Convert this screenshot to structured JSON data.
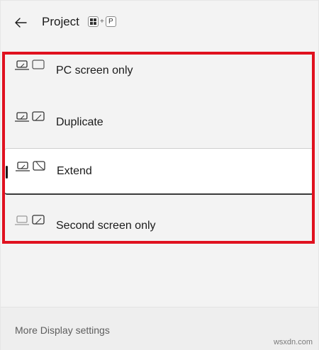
{
  "header": {
    "title": "Project",
    "shortcut": {
      "plus": "+",
      "key": "P"
    }
  },
  "modes": [
    {
      "label": "PC screen only",
      "icon": "pc-screen-only-icon",
      "selected": false
    },
    {
      "label": "Duplicate",
      "icon": "duplicate-icon",
      "selected": false
    },
    {
      "label": "Extend",
      "icon": "extend-icon",
      "selected": true
    },
    {
      "label": "Second screen only",
      "icon": "second-screen-only-icon",
      "selected": false
    }
  ],
  "footer": {
    "link": "More Display settings"
  },
  "watermark": "wsxdn.com",
  "colors": {
    "highlight_border": "#e0111f",
    "background": "#f3f3f3",
    "selected_bg": "#ffffff"
  }
}
